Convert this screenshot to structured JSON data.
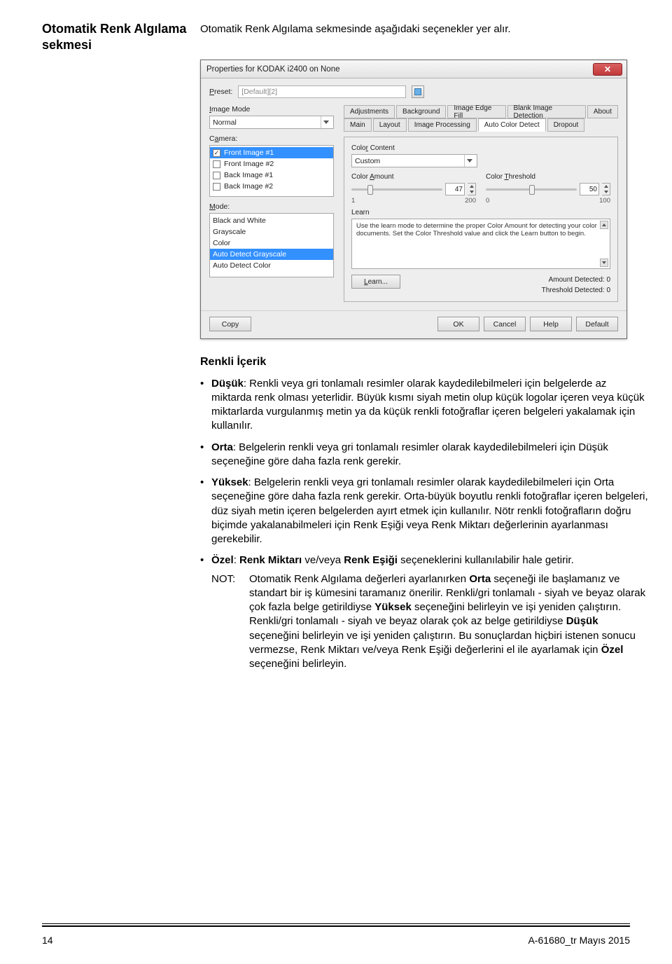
{
  "page": {
    "heading_left": "Otomatik Renk Algılama sekmesi",
    "heading_right": "Otomatik Renk Algılama sekmesinde aşağıdaki seçenekler yer alır.",
    "footer_left": "14",
    "footer_right": "A-61680_tr  Mayıs 2015"
  },
  "dialog": {
    "title": "Properties for KODAK i2400 on None",
    "preset_label": "Preset:",
    "preset_value": "[Default][2]",
    "image_mode_label": "Image Mode",
    "image_mode_value": "Normal",
    "camera_label": "Camera:",
    "camera_items": [
      {
        "label": "Front Image #1",
        "checked": true,
        "selected": true
      },
      {
        "label": "Front Image #2",
        "checked": false,
        "selected": false
      },
      {
        "label": "Back Image #1",
        "checked": false,
        "selected": false
      },
      {
        "label": "Back Image #2",
        "checked": false,
        "selected": false
      }
    ],
    "mode_label": "Mode:",
    "mode_items": [
      {
        "label": "Black and White",
        "selected": false
      },
      {
        "label": "Grayscale",
        "selected": false
      },
      {
        "label": "Color",
        "selected": false
      },
      {
        "label": "Auto Detect Grayscale",
        "selected": true
      },
      {
        "label": "Auto Detect Color",
        "selected": false
      }
    ],
    "tabs_row1": [
      "Adjustments",
      "Background",
      "Image Edge Fill",
      "Blank Image Detection",
      "About"
    ],
    "tabs_row2": [
      "Main",
      "Layout",
      "Image Processing",
      "Auto Color Detect",
      "Dropout"
    ],
    "active_tab": "Auto Color Detect",
    "color_content_label": "Color Content",
    "color_content_value": "Custom",
    "color_amount_label": "Color Amount",
    "color_amount_value": "47",
    "color_amount_min": "1",
    "color_amount_max": "200",
    "color_threshold_label": "Color Threshold",
    "color_threshold_value": "50",
    "color_threshold_min": "0",
    "color_threshold_max": "100",
    "learn_label": "Learn",
    "learn_text": "Use the learn mode to determine the proper Color Amount for detecting your color documents. Set the Color Threshold value and click the Learn button to begin.",
    "learn_button": "Learn...",
    "amount_detected_label": "Amount Detected:",
    "amount_detected_value": "0",
    "threshold_detected_label": "Threshold Detected:",
    "threshold_detected_value": "0",
    "footer_buttons": [
      "Copy",
      "OK",
      "Cancel",
      "Help",
      "Default"
    ]
  },
  "content": {
    "section_title": "Renkli İçerik",
    "items": {
      "dusuk": {
        "label": "Düşük",
        "text": ": Renkli veya gri tonlamalı resimler olarak kaydedilebilmeleri için belgelerde az miktarda renk olması yeterlidir. Büyük kısmı siyah metin olup küçük logolar içeren veya küçük miktarlarda vurgulanmış metin ya da küçük renkli fotoğraflar içeren belgeleri yakalamak için kullanılır."
      },
      "orta": {
        "label": "Orta",
        "text": ": Belgelerin renkli veya gri tonlamalı resimler olarak kaydedilebilmeleri için Düşük seçeneğine göre daha fazla renk gerekir."
      },
      "yuksek": {
        "label": "Yüksek",
        "text": ": Belgelerin renkli veya gri tonlamalı resimler olarak kaydedilebilmeleri için Orta seçeneğine göre daha fazla renk gerekir. Orta-büyük boyutlu renkli fotoğraflar içeren belgeleri, düz siyah metin içeren belgelerden ayırt etmek için kullanılır. Nötr renkli fotoğrafların doğru biçimde yakalanabilmeleri için Renk Eşiği veya Renk Miktarı değerlerinin ayarlanması gerekebilir."
      },
      "ozel": {
        "label": "Özel",
        "part1": ": ",
        "b1": "Renk Miktarı",
        "mid": " ve/veya ",
        "b2": "Renk Eşiği",
        "part2": " seçeneklerini kullanılabilir hale getirir."
      },
      "not": {
        "label": "NOT:",
        "p1a": "Otomatik Renk Algılama değerleri ayarlanırken ",
        "p1b": "Orta",
        "p1c": " seçeneği ile başlamanız ve standart bir iş kümesini taramanız önerilir. Renkli/gri tonlamalı - siyah ve beyaz olarak çok fazla belge getirildiyse ",
        "p1d": "Yüksek",
        "p1e": " seçeneğini belirleyin ve işi yeniden çalıştırın. Renkli/gri tonlamalı - siyah ve beyaz olarak çok az belge getirildiyse ",
        "p1f": "Düşük",
        "p1g": " seçeneğini belirleyin ve işi yeniden çalıştırın. Bu sonuçlardan hiçbiri istenen sonucu vermezse, Renk Miktarı ve/veya Renk Eşiği değerlerini el ile ayarlamak için ",
        "p1h": "Özel",
        "p1i": " seçeneğini belirleyin."
      }
    }
  }
}
